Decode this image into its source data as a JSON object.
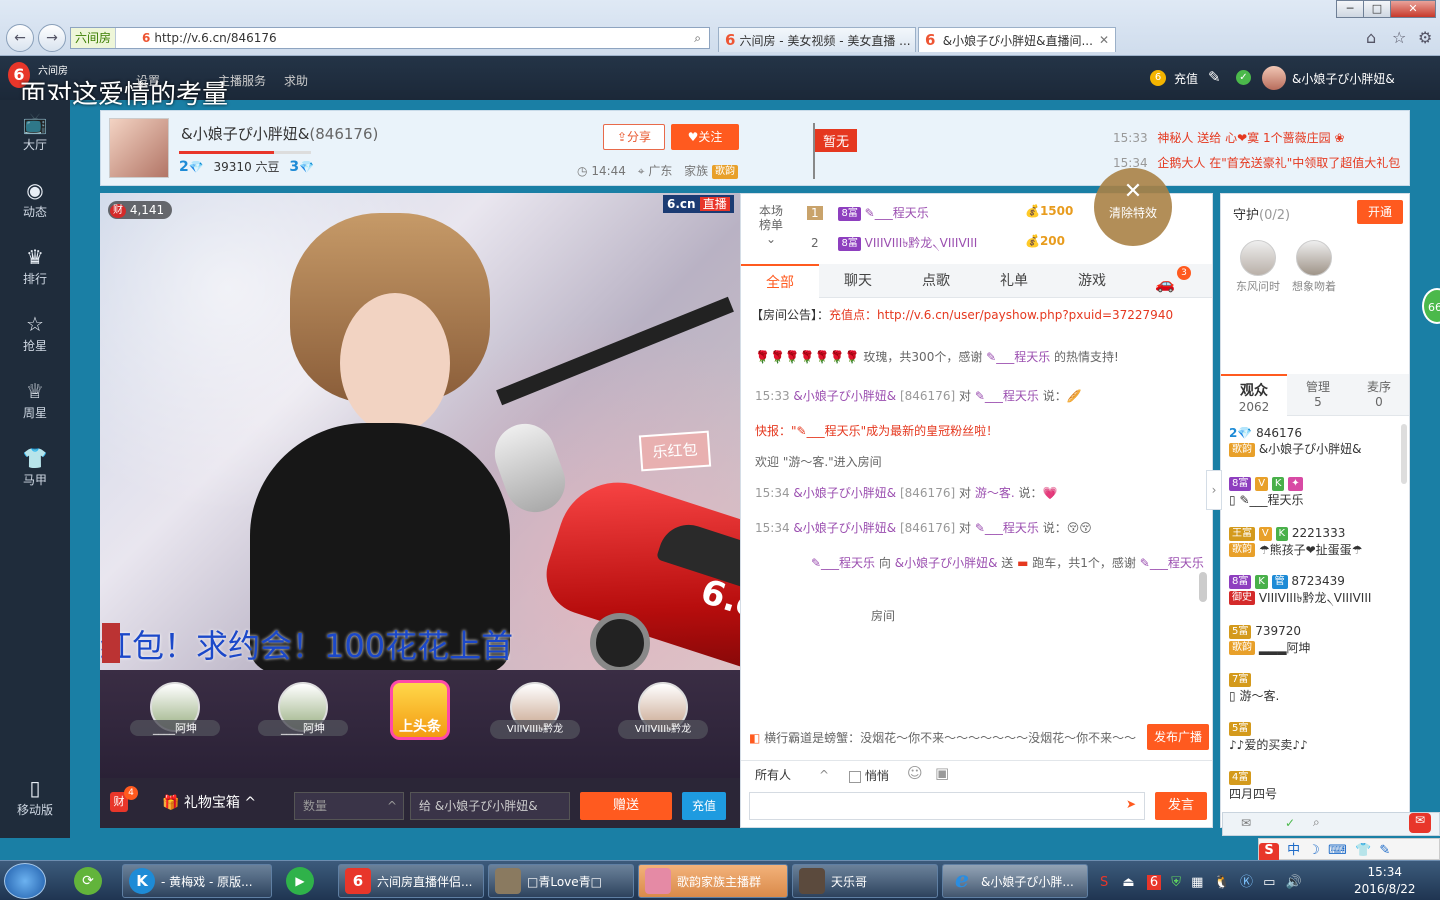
{
  "browser": {
    "back": "←",
    "forward": "→",
    "site_badge": "六间房",
    "url": "http://v.6.cn/846176",
    "tabs": [
      {
        "label": "六间房 - 美女视频 - 美女直播 ..."
      },
      {
        "label": "&小娘子ぴ小胖妞&直播间..."
      }
    ],
    "win_min": "─",
    "win_max": "□",
    "win_close": "✕"
  },
  "site_header": {
    "logo": "六间房",
    "overlay_title": "面对这爱情的考量",
    "nav": [
      "设置",
      "主播服务",
      "求助"
    ],
    "recharge": "充值",
    "username": "&小娘子ぴ小胖妞&"
  },
  "sidebar": {
    "items": [
      {
        "label": "大厅",
        "icon": "tv-icon"
      },
      {
        "label": "动态",
        "icon": "compass-icon"
      },
      {
        "label": "排行",
        "icon": "crown-icon"
      },
      {
        "label": "抢星",
        "icon": "star-icon"
      },
      {
        "label": "周星",
        "icon": "cup-icon"
      },
      {
        "label": "马甲",
        "icon": "shirt-icon"
      }
    ],
    "mobile": "移动版"
  },
  "anchor": {
    "name": "&小娘子ぴ小胖妞&",
    "room_id": "(846176)",
    "level": "2",
    "beans": "39310 六豆",
    "level2": "3",
    "share": "分享",
    "follow": "关注",
    "time": "14:44",
    "location": "广东",
    "family": "家族",
    "family_badge": "歌韵",
    "flag": "暂无"
  },
  "notices": [
    {
      "time": "15:33",
      "text_a": "神秘人",
      "text_b": "送给",
      "text_c": "心❤寞",
      "text_d": "1个蔷薇庄园"
    },
    {
      "time": "15:34",
      "text_a": "企鹅大人",
      "text_b": "在\"首充送豪礼\"中领取了超值大礼包"
    }
  ],
  "video": {
    "viewers_badge": "财",
    "viewers": "4,141",
    "brand": "6.cn",
    "live": "直播",
    "marquee": "红包！求约会！100花花上首",
    "redpack": "乐红包",
    "car_brand": "6.cn"
  },
  "guards_row": [
    {
      "name": "____阿坤"
    },
    {
      "name": "____阿坤"
    },
    {
      "name": "上头条"
    },
    {
      "name": "VIIIVIII৳黔龙"
    },
    {
      "name": "VIIIVIII৳黔龙"
    }
  ],
  "giftbar": {
    "cai": "财",
    "cai_count": "4",
    "giftbox": "礼物宝箱",
    "qty_placeholder": "数量",
    "to_prefix": "给",
    "to_name": "&小娘子ぴ小胖妞&",
    "send": "赠送",
    "recharge": "充值"
  },
  "rank": {
    "label1": "本场",
    "label2": "榜单",
    "rows": [
      {
        "rank": "1",
        "badge": "8富",
        "name": "✎___程天乐",
        "score": "1500"
      },
      {
        "rank": "2",
        "badge": "8富",
        "name": "VIIIVIII৳黔龙৲VIIIVIII",
        "score": "200"
      }
    ],
    "clear_fx": "清除特效"
  },
  "chat_tabs": [
    "全部",
    "聊天",
    "点歌",
    "礼单",
    "游戏"
  ],
  "car_count": "3",
  "chat": {
    "notice_label": "【房间公告】：",
    "notice_text": "充值点：http://v.6.cn/user/payshow.php?pxuid=37227940",
    "rose_icons": "🌹🌹🌹🌹🌹🌹🌹",
    "rose_text": "玫瑰，共300个，感谢",
    "rose_user": "✎___程天乐",
    "rose_tail": "的热情支持!",
    "m1_time": "15:33",
    "m1_from": "&小娘子ぴ小胖妞&",
    "m1_id": "[846176]",
    "m1_to": "对",
    "m1_user": "✎___程天乐",
    "m1_say": "说：",
    "flash_label": "快报：",
    "flash_text": "\"✎___程天乐\"成为最新的皇冠粉丝啦！",
    "welcome": "欢迎 \"游～客.\"进入房间",
    "m2_time": "15:34",
    "m2_from": "&小娘子ぴ小胖妞&",
    "m2_id": "[846176]",
    "m2_to": "对",
    "m2_user": "游～客.",
    "m2_say": "说：",
    "m3_time": "15:34",
    "m3_from": "&小娘子ぴ小胖妞&",
    "m3_id": "[846176]",
    "m3_to": "对",
    "m3_user": "✎___程天乐",
    "m3_say": "说：",
    "m4_a": "✎___程天乐",
    "m4_b": "向",
    "m4_c": "&小娘子ぴ小胖妞&",
    "m4_d": "送",
    "m4_e": "跑车，共1个，感谢",
    "m4_f": "✎___程天乐",
    "m5": "房间",
    "broadcast_text": "横行霸道是螃蟹：没烟花～你不来～～～～～～～没烟花～你不来～～",
    "broadcast_btn": "发布广播",
    "audience_select": "所有人",
    "whisper": "悄悄",
    "send": "发言"
  },
  "guard_panel": {
    "title": "守护",
    "count": "(0/2)",
    "open": "开通",
    "guards": [
      "东风问时",
      "想象吻着"
    ]
  },
  "audience_tabs": [
    {
      "label": "观众",
      "count": "2062"
    },
    {
      "label": "管理",
      "count": "5"
    },
    {
      "label": "麦序",
      "count": "0"
    }
  ],
  "users": [
    {
      "line1": "846176",
      "b1": "2",
      "line2": "&小娘子ぴ小胖妞&",
      "b2": "歌韵"
    },
    {
      "line1": "",
      "b1": "8富",
      "line2": "✎___程天乐",
      "b2": ""
    },
    {
      "line1": "2221333",
      "b1": "王富",
      "line2": "☂熊孩子❤扯蛋蛋☂",
      "b2": "歌韵"
    },
    {
      "line1": "8723439",
      "b1": "8富",
      "line2": "VIIIVIII৳黔龙৲VIIIVIII",
      "b2": "御史"
    },
    {
      "line1": "739720",
      "b1": "5富",
      "line2": "▂▂▂阿坤",
      "b2": "歌韵"
    },
    {
      "line1": "",
      "b1": "7富",
      "line2": "游～客.",
      "b2": ""
    },
    {
      "line1": "",
      "b1": "5富",
      "line2": "♪♪爱的买卖♪♪",
      "b2": ""
    },
    {
      "line1": "",
      "b1": "4富",
      "line2": "四月四号",
      "b2": ""
    }
  ],
  "float_badge": "66",
  "taskbar": {
    "items": [
      "- 黄梅戏 - 原版...",
      "六间房直播伴侣...",
      "□青Love青□",
      "歌韵家族主播群",
      "天乐哥",
      "&小娘子ぴ小胖..."
    ],
    "time": "15:34",
    "date": "2016/8/22",
    "ime": "中"
  },
  "colors": {
    "accent": "#ff5a1f",
    "sidebar": "#1f2c3b",
    "chat_nick": "#9b4fb0",
    "notice_red": "#e5381f"
  }
}
